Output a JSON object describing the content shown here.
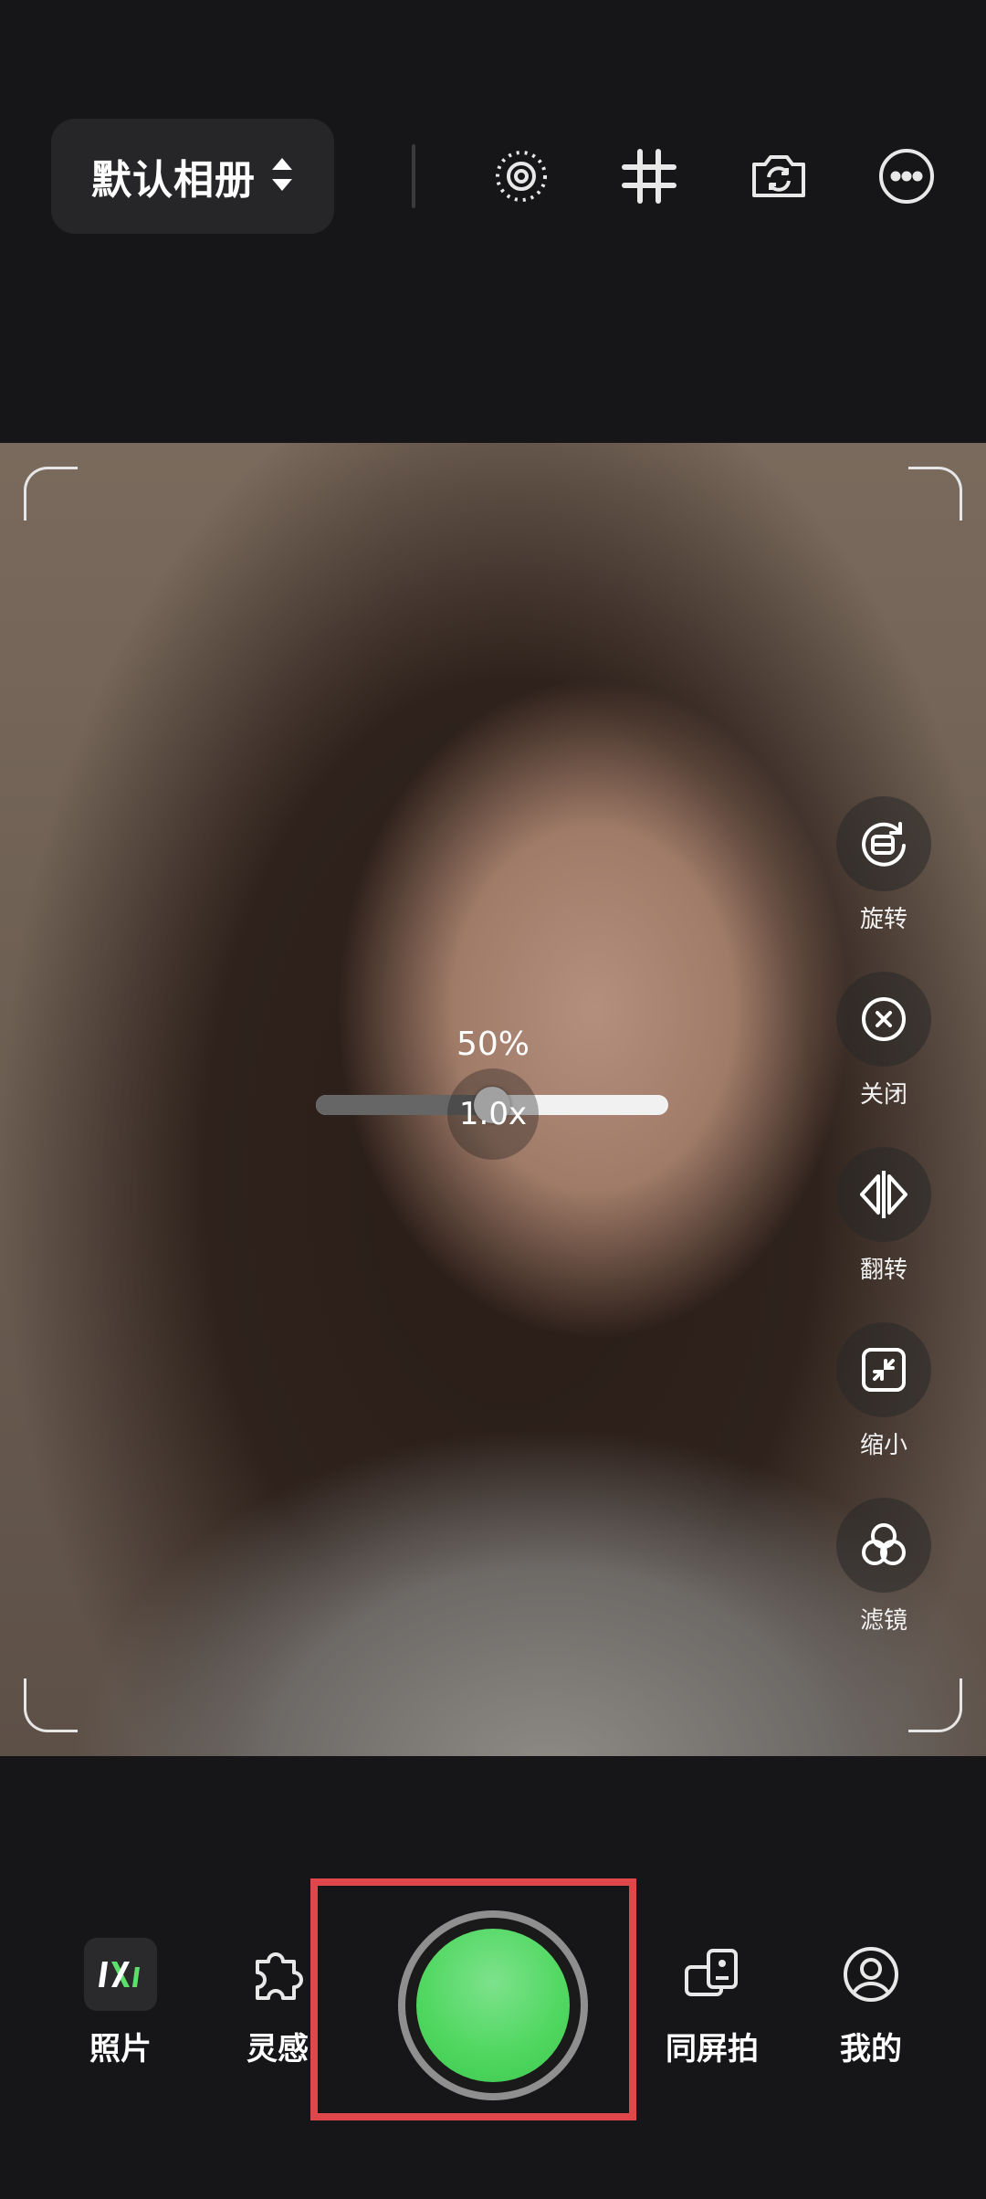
{
  "top_bar": {
    "album_label": "默认相册",
    "icons": [
      "light-icon",
      "grid-icon",
      "switch-camera-icon",
      "more-icon"
    ]
  },
  "viewfinder": {
    "opacity_label": "50%",
    "opacity_value": 50,
    "zoom_label": "1.0x"
  },
  "side_tools": [
    {
      "label": "旋转",
      "icon": "rotate-icon"
    },
    {
      "label": "关闭",
      "icon": "close-icon"
    },
    {
      "label": "翻转",
      "icon": "flip-icon"
    },
    {
      "label": "缩小",
      "icon": "shrink-icon"
    },
    {
      "label": "滤镜",
      "icon": "filter-icon"
    }
  ],
  "bottom_bar": {
    "photos_label": "照片",
    "inspiration_label": "灵感",
    "same_screen_label": "同屏拍",
    "mine_label": "我的"
  },
  "colors": {
    "background": "#161618",
    "shutter_green": "#52d862",
    "highlight_red": "#e0474a",
    "logo_green": "#5be06a"
  }
}
